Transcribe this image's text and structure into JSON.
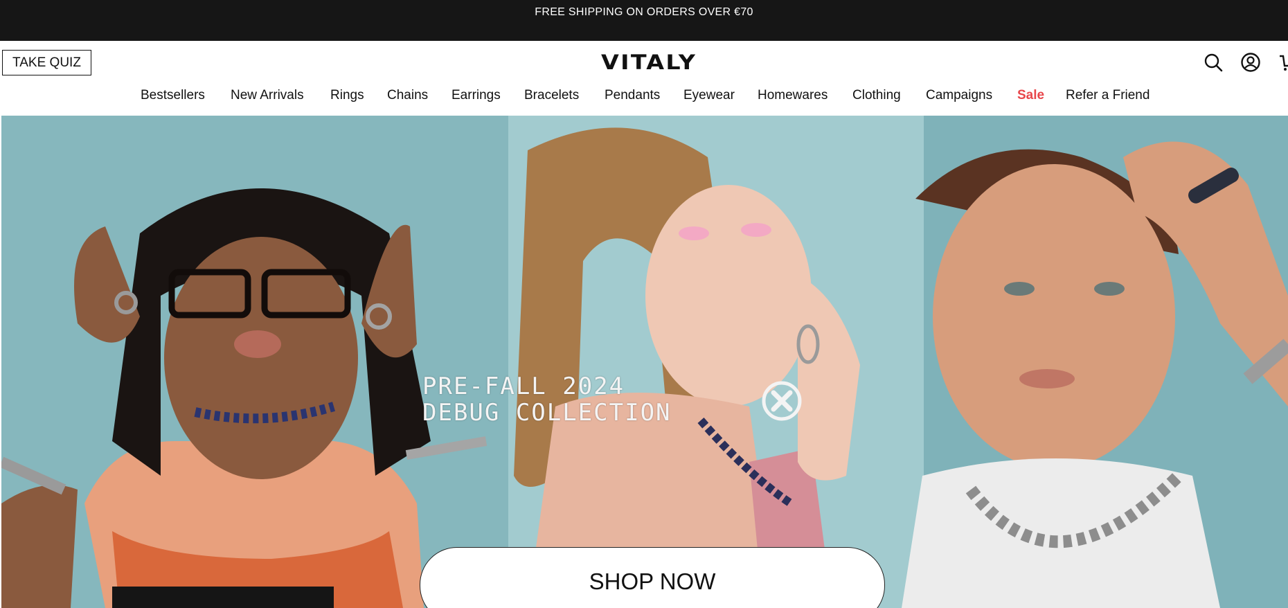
{
  "announcement": {
    "text": "FREE SHIPPING ON ORDERS OVER €70"
  },
  "header": {
    "quiz_label": "TAKE QUIZ",
    "logo": "VITALY",
    "icons": [
      "search-icon",
      "account-icon",
      "cart-icon"
    ]
  },
  "nav": {
    "items": [
      {
        "label": "Bestsellers"
      },
      {
        "label": "New Arrivals"
      },
      {
        "label": "Rings"
      },
      {
        "label": "Chains"
      },
      {
        "label": "Earrings"
      },
      {
        "label": "Bracelets"
      },
      {
        "label": "Pendants"
      },
      {
        "label": "Eyewear"
      },
      {
        "label": "Homewares"
      },
      {
        "label": "Clothing"
      },
      {
        "label": "Campaigns"
      },
      {
        "label": "Sale"
      },
      {
        "label": "Refer a Friend"
      }
    ]
  },
  "hero": {
    "title_line1": "PRE-FALL 2024",
    "title_line2": "DEBUG COLLECTION",
    "cta": "SHOP NOW"
  },
  "colors": {
    "announcement_bg": "#161616",
    "sale": "#e8474b",
    "hero_backdrop": "#8fbfc4"
  }
}
